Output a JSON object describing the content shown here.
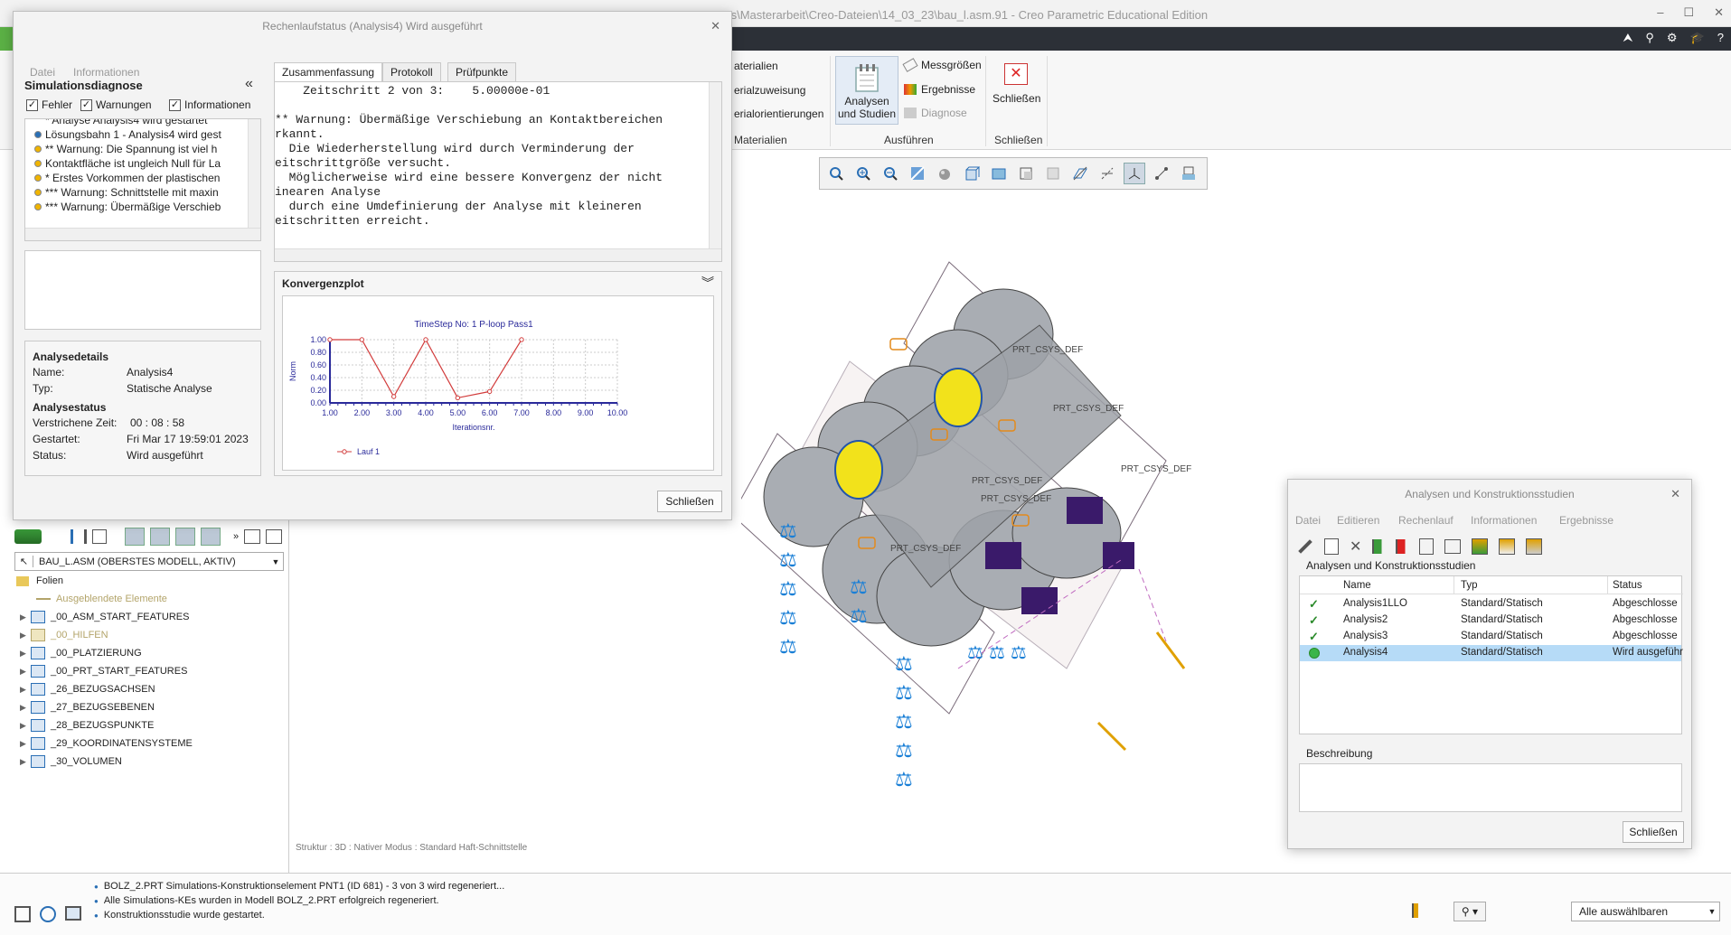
{
  "app": {
    "title": "ts\\Masterarbeit\\Creo-Dateien\\14_03_23\\bau_l.asm.91 - Creo Parametric Educational Edition",
    "window_controls": [
      "–",
      "☐",
      "✕"
    ],
    "accent_color": "#5bb045"
  },
  "ribbon": {
    "materials": [
      "aterialien",
      "erialzuweisung",
      "erialorientierungen"
    ],
    "materials_group": "Materialien",
    "analysen_button": "Analysen\nund Studien",
    "analysen_line1": "Analysen",
    "analysen_line2": "und Studien",
    "messgroessen": "Messgrößen",
    "ergebnisse": "Ergebnisse",
    "diagnose": "Diagnose",
    "ausfuehren_group": "Ausführen",
    "schliessen_button": "Schließen",
    "schliessen_group": "Schließen"
  },
  "graphics": {
    "csys_labels": [
      "PRT_CSYS_DEF",
      "PRT_CSYS_DEF",
      "PRT_CSYS_DEF",
      "PRT_CSYS_DEF",
      "PRT_CSYS_DEF",
      "PRT_CSYS_DEF"
    ],
    "status_structure": "Struktur : 3D : Nativer Modus : Standard Haft-Schnittstelle"
  },
  "model_tree": {
    "model_dropdown": "BAU_L.ASM (OBERSTES MODELL, AKTIV)",
    "folien": "Folien",
    "hidden": "Ausgeblendete Elemente",
    "items": [
      {
        "label": "_00_ASM_START_FEATURES",
        "muted": false
      },
      {
        "label": "_00_HILFEN",
        "muted": true
      },
      {
        "label": "_00_PLATZIERUNG",
        "muted": false
      },
      {
        "label": "_00_PRT_START_FEATURES",
        "muted": false
      },
      {
        "label": "_26_BEZUGSACHSEN",
        "muted": false
      },
      {
        "label": "_27_BEZUGSEBENEN",
        "muted": false
      },
      {
        "label": "_28_BEZUGSPUNKTE",
        "muted": false
      },
      {
        "label": "_29_KOORDINATENSYSTEME",
        "muted": false
      },
      {
        "label": "_30_VOLUMEN",
        "muted": false
      }
    ]
  },
  "messages": [
    "BOLZ_2.PRT Simulations-Konstruktionselement PNT1 (ID 681) - 3 von 3 wird regeneriert...",
    "Alle Simulations-KEs wurden in Modell BOLZ_2.PRT erfolgreich regeneriert.",
    "Konstruktionsstudie wurde gestartet."
  ],
  "select_all": "Alle auswählbaren",
  "run_dialog": {
    "title": "Rechenlaufstatus (Analysis4) Wird ausgeführt",
    "menu": [
      "Datei",
      "Informationen"
    ],
    "diag_title": "Simulationsdiagnose",
    "filters": [
      {
        "label": "Fehler",
        "checked": true
      },
      {
        "label": "Warnungen",
        "checked": true
      },
      {
        "label": "Informationen",
        "checked": true
      }
    ],
    "diag_items": [
      {
        "text": "* Analyse Analysis4 wird gestartet",
        "color": "none"
      },
      {
        "text": "Lösungsbahn 1 - Analysis4 wird gest",
        "color": "#2a6fb5"
      },
      {
        "text": "** Warnung:  Die Spannung ist viel h",
        "color": "#f0b400"
      },
      {
        "text": "Kontaktfläche ist ungleich Null für La",
        "color": "#f0b400"
      },
      {
        "text": "* Erstes Vorkommen der plastischen",
        "color": "#f0b400"
      },
      {
        "text": "*** Warnung: Schnittstelle mit maxin",
        "color": "#f0b400"
      },
      {
        "text": "*** Warnung: Übermäßige Verschieb",
        "color": "#f0b400"
      }
    ],
    "details_title": "Analysedetails",
    "name_label": "Name:",
    "name_value": "Analysis4",
    "type_label": "Typ:",
    "type_value": "Statische Analyse",
    "status_title": "Analysestatus",
    "elapsed_label": "Verstrichene Zeit:",
    "elapsed_value": "00 : 08 : 58",
    "started_label": "Gestartet:",
    "started_value": "Fri Mar 17 19:59:01 2023",
    "status_label": "Status:",
    "status_value": "Wird ausgeführt",
    "tabs": [
      "Zusammenfassung",
      "Protokoll",
      "Prüfpunkte"
    ],
    "log_lines": [
      "    Zeitschritt 2 von 3:    5.00000e-01",
      "",
      "** Warnung: Übermäßige Verschiebung an Kontaktbereichen",
      "rkannt.",
      "  Die Wiederherstellung wird durch Verminderung der",
      "eitschrittgröße versucht.",
      "  Möglicherweise wird eine bessere Konvergenz der nicht",
      "inearen Analyse",
      "  durch eine Umdefinierung der Analyse mit kleineren",
      "eitschritten erreicht."
    ],
    "plot_panel_title": "Konvergenzplot",
    "close_button": "Schließen"
  },
  "chart_data": {
    "type": "line",
    "title": "TimeStep No:  1  P-loop Pass1",
    "xlabel": "Iterationsnr.",
    "ylabel": "Norm",
    "xlim": [
      1,
      10
    ],
    "ylim": [
      0,
      1
    ],
    "xticks": [
      "1.00",
      "2.00",
      "3.00",
      "4.00",
      "5.00",
      "6.00",
      "7.00",
      "8.00",
      "9.00",
      "10.00"
    ],
    "yticks": [
      "0.00",
      "0.20",
      "0.40",
      "0.60",
      "0.80",
      "1.00"
    ],
    "grid": true,
    "legend": "bottom-left",
    "series": [
      {
        "name": "Lauf 1",
        "color": "#d23c3c",
        "x": [
          1,
          2,
          3,
          4,
          5,
          6,
          7
        ],
        "y": [
          1.0,
          1.0,
          0.1,
          1.0,
          0.08,
          0.18,
          1.0
        ]
      }
    ]
  },
  "studies_dialog": {
    "title": "Analysen und Konstruktionsstudien",
    "menu": [
      "Datei",
      "Editieren",
      "Rechenlauf",
      "Informationen",
      "Ergebnisse"
    ],
    "group_title": "Analysen und Konstruktionsstudien",
    "columns": [
      "Name",
      "Typ",
      "Status"
    ],
    "rows": [
      {
        "name": "Analysis1LLO",
        "type": "Standard/Statisch",
        "status": "Abgeschlosse",
        "icon": "check-icon",
        "selected": false
      },
      {
        "name": "Analysis2",
        "type": "Standard/Statisch",
        "status": "Abgeschlosse",
        "icon": "check-icon",
        "selected": false
      },
      {
        "name": "Analysis3",
        "type": "Standard/Statisch",
        "status": "Abgeschlosse",
        "icon": "check-icon",
        "selected": false
      },
      {
        "name": "Analysis4",
        "type": "Standard/Statisch",
        "status": "Wird ausgeführ",
        "icon": "running-icon",
        "selected": true
      }
    ],
    "description_label": "Beschreibung",
    "close_button": "Schließen"
  }
}
